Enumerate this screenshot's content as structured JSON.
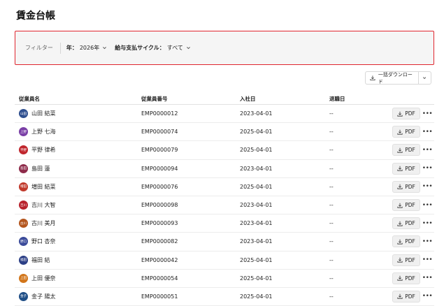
{
  "page": {
    "title": "賃金台帳"
  },
  "filters": {
    "label": "フィルター",
    "year_key": "年：",
    "year_value": "2026年",
    "cycle_key": "給与支払サイクル：",
    "cycle_value": "すべて"
  },
  "toolbar": {
    "bulk_download_label": "一括ダウンロード"
  },
  "table": {
    "headers": {
      "name": "従業員名",
      "number": "従業員番号",
      "join": "入社日",
      "leave": "退職日"
    },
    "pdf_label": "PDF",
    "more_label": "•••",
    "rows": [
      {
        "avatar": "山田",
        "avatar_color": "#2f4f8f",
        "name": "山田 結菜",
        "number": "EMP0000012",
        "join": "2023-04-01",
        "leave": "--"
      },
      {
        "avatar": "上野",
        "avatar_color": "#7a3fa6",
        "name": "上野 七海",
        "number": "EMP0000074",
        "join": "2025-04-01",
        "leave": "--"
      },
      {
        "avatar": "平野",
        "avatar_color": "#c0262d",
        "name": "平野 律希",
        "number": "EMP0000079",
        "join": "2025-04-01",
        "leave": "--"
      },
      {
        "avatar": "島田",
        "avatar_color": "#8e2b4a",
        "name": "島田 蓮",
        "number": "EMP0000094",
        "join": "2023-04-01",
        "leave": "--"
      },
      {
        "avatar": "増田",
        "avatar_color": "#c0392b",
        "name": "増田 結菜",
        "number": "EMP0000076",
        "join": "2025-04-01",
        "leave": "--"
      },
      {
        "avatar": "吉川",
        "avatar_color": "#b8222c",
        "name": "吉川 大智",
        "number": "EMP0000098",
        "join": "2023-04-01",
        "leave": "--"
      },
      {
        "avatar": "古川",
        "avatar_color": "#b4561e",
        "name": "古川 美月",
        "number": "EMP0000093",
        "join": "2023-04-01",
        "leave": "--"
      },
      {
        "avatar": "野口",
        "avatar_color": "#3b4b9a",
        "name": "野口 杏奈",
        "number": "EMP0000082",
        "join": "2023-04-01",
        "leave": "--"
      },
      {
        "avatar": "福田",
        "avatar_color": "#2c3f86",
        "name": "福田 結",
        "number": "EMP0000042",
        "join": "2025-04-01",
        "leave": "--"
      },
      {
        "avatar": "上田",
        "avatar_color": "#d2761b",
        "name": "上田 優奈",
        "number": "EMP0000054",
        "join": "2025-04-01",
        "leave": "--"
      },
      {
        "avatar": "金子",
        "avatar_color": "#1f4e86",
        "name": "金子 陽太",
        "number": "EMP0000051",
        "join": "2025-04-01",
        "leave": "--"
      }
    ]
  }
}
